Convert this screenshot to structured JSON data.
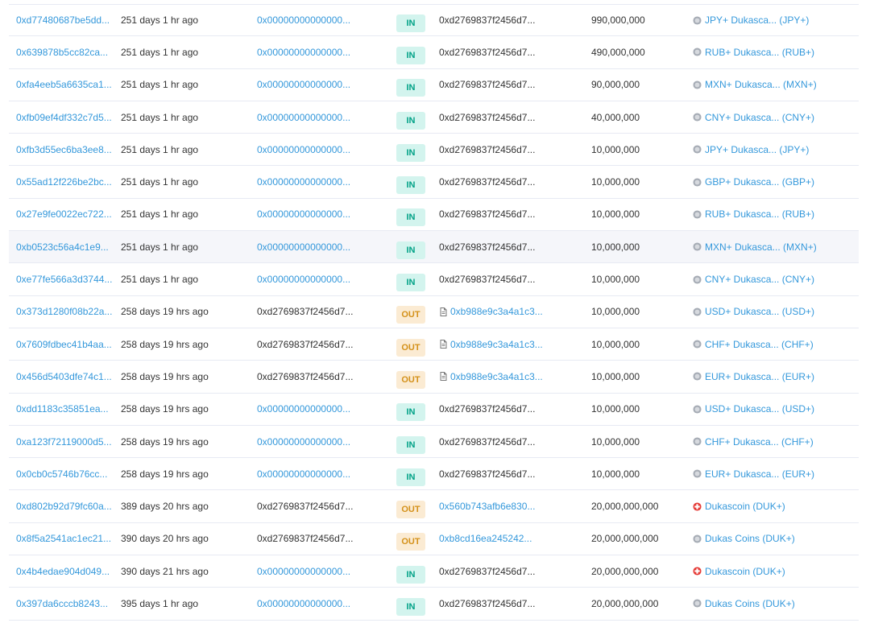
{
  "colors": {
    "link": "#3498db",
    "in_badge_bg": "#d3f4ee",
    "in_badge_text": "#00a186",
    "out_badge_bg": "#fbebd3",
    "out_badge_text": "#d4911a",
    "duk_icon": "#e53935"
  },
  "rows": [
    {
      "hash": "0xd77480687be5dd...",
      "age": "251 days 1 hr ago",
      "from": "0x00000000000000...",
      "from_link": true,
      "direction": "IN",
      "to": "0xd2769837f2456d7...",
      "to_link": false,
      "to_contract": false,
      "quantity": "990,000,000",
      "token": "JPY+ Dukasca... (JPY+)",
      "token_icon": "gray-token-icon"
    },
    {
      "hash": "0x639878b5cc82ca...",
      "age": "251 days 1 hr ago",
      "from": "0x00000000000000...",
      "from_link": true,
      "direction": "IN",
      "to": "0xd2769837f2456d7...",
      "to_link": false,
      "to_contract": false,
      "quantity": "490,000,000",
      "token": "RUB+ Dukasca... (RUB+)",
      "token_icon": "gray-token-icon"
    },
    {
      "hash": "0xfa4eeb5a6635ca1...",
      "age": "251 days 1 hr ago",
      "from": "0x00000000000000...",
      "from_link": true,
      "direction": "IN",
      "to": "0xd2769837f2456d7...",
      "to_link": false,
      "to_contract": false,
      "quantity": "90,000,000",
      "token": "MXN+ Dukasca... (MXN+)",
      "token_icon": "gray-token-icon"
    },
    {
      "hash": "0xfb09ef4df332c7d5...",
      "age": "251 days 1 hr ago",
      "from": "0x00000000000000...",
      "from_link": true,
      "direction": "IN",
      "to": "0xd2769837f2456d7...",
      "to_link": false,
      "to_contract": false,
      "quantity": "40,000,000",
      "token": "CNY+ Dukasca... (CNY+)",
      "token_icon": "gray-token-icon"
    },
    {
      "hash": "0xfb3d55ec6ba3ee8...",
      "age": "251 days 1 hr ago",
      "from": "0x00000000000000...",
      "from_link": true,
      "direction": "IN",
      "to": "0xd2769837f2456d7...",
      "to_link": false,
      "to_contract": false,
      "quantity": "10,000,000",
      "token": "JPY+ Dukasca... (JPY+)",
      "token_icon": "gray-token-icon"
    },
    {
      "hash": "0x55ad12f226be2bc...",
      "age": "251 days 1 hr ago",
      "from": "0x00000000000000...",
      "from_link": true,
      "direction": "IN",
      "to": "0xd2769837f2456d7...",
      "to_link": false,
      "to_contract": false,
      "quantity": "10,000,000",
      "token": "GBP+ Dukasca... (GBP+)",
      "token_icon": "gray-token-icon"
    },
    {
      "hash": "0x27e9fe0022ec722...",
      "age": "251 days 1 hr ago",
      "from": "0x00000000000000...",
      "from_link": true,
      "direction": "IN",
      "to": "0xd2769837f2456d7...",
      "to_link": false,
      "to_contract": false,
      "quantity": "10,000,000",
      "token": "RUB+ Dukasca... (RUB+)",
      "token_icon": "gray-token-icon"
    },
    {
      "hash": "0xb0523c56a4c1e9...",
      "age": "251 days 1 hr ago",
      "from": "0x00000000000000...",
      "from_link": true,
      "direction": "IN",
      "to": "0xd2769837f2456d7...",
      "to_link": false,
      "to_contract": false,
      "quantity": "10,000,000",
      "token": "MXN+ Dukasca... (MXN+)",
      "token_icon": "gray-token-icon",
      "highlight": true
    },
    {
      "hash": "0xe77fe566a3d3744...",
      "age": "251 days 1 hr ago",
      "from": "0x00000000000000...",
      "from_link": true,
      "direction": "IN",
      "to": "0xd2769837f2456d7...",
      "to_link": false,
      "to_contract": false,
      "quantity": "10,000,000",
      "token": "CNY+ Dukasca... (CNY+)",
      "token_icon": "gray-token-icon"
    },
    {
      "hash": "0x373d1280f08b22a...",
      "age": "258 days 19 hrs ago",
      "from": "0xd2769837f2456d7...",
      "from_link": false,
      "direction": "OUT",
      "to": "0xb988e9c3a4a1c3...",
      "to_link": true,
      "to_contract": true,
      "quantity": "10,000,000",
      "token": "USD+ Dukasca... (USD+)",
      "token_icon": "gray-token-icon"
    },
    {
      "hash": "0x7609fdbec41b4aa...",
      "age": "258 days 19 hrs ago",
      "from": "0xd2769837f2456d7...",
      "from_link": false,
      "direction": "OUT",
      "to": "0xb988e9c3a4a1c3...",
      "to_link": true,
      "to_contract": true,
      "quantity": "10,000,000",
      "token": "CHF+ Dukasca... (CHF+)",
      "token_icon": "gray-token-icon"
    },
    {
      "hash": "0x456d5403dfe74c1...",
      "age": "258 days 19 hrs ago",
      "from": "0xd2769837f2456d7...",
      "from_link": false,
      "direction": "OUT",
      "to": "0xb988e9c3a4a1c3...",
      "to_link": true,
      "to_contract": true,
      "quantity": "10,000,000",
      "token": "EUR+ Dukasca... (EUR+)",
      "token_icon": "gray-token-icon"
    },
    {
      "hash": "0xdd1183c35851ea...",
      "age": "258 days 19 hrs ago",
      "from": "0x00000000000000...",
      "from_link": true,
      "direction": "IN",
      "to": "0xd2769837f2456d7...",
      "to_link": false,
      "to_contract": false,
      "quantity": "10,000,000",
      "token": "USD+ Dukasca... (USD+)",
      "token_icon": "gray-token-icon"
    },
    {
      "hash": "0xa123f72119000d5...",
      "age": "258 days 19 hrs ago",
      "from": "0x00000000000000...",
      "from_link": true,
      "direction": "IN",
      "to": "0xd2769837f2456d7...",
      "to_link": false,
      "to_contract": false,
      "quantity": "10,000,000",
      "token": "CHF+ Dukasca... (CHF+)",
      "token_icon": "gray-token-icon"
    },
    {
      "hash": "0x0cb0c5746b76cc...",
      "age": "258 days 19 hrs ago",
      "from": "0x00000000000000...",
      "from_link": true,
      "direction": "IN",
      "to": "0xd2769837f2456d7...",
      "to_link": false,
      "to_contract": false,
      "quantity": "10,000,000",
      "token": "EUR+ Dukasca... (EUR+)",
      "token_icon": "gray-token-icon"
    },
    {
      "hash": "0xd802b92d79fc60a...",
      "age": "389 days 20 hrs ago",
      "from": "0xd2769837f2456d7...",
      "from_link": false,
      "direction": "OUT",
      "to": "0x560b743afb6e830...",
      "to_link": true,
      "to_contract": false,
      "quantity": "20,000,000,000",
      "token": "Dukascoin (DUK+)",
      "token_icon": "red-cross-token-icon"
    },
    {
      "hash": "0x8f5a2541ac1ec21...",
      "age": "390 days 20 hrs ago",
      "from": "0xd2769837f2456d7...",
      "from_link": false,
      "direction": "OUT",
      "to": "0xb8cd16ea245242...",
      "to_link": true,
      "to_contract": false,
      "quantity": "20,000,000,000",
      "token": "Dukas Coins (DUK+)",
      "token_icon": "gray-token-icon"
    },
    {
      "hash": "0x4b4edae904d049...",
      "age": "390 days 21 hrs ago",
      "from": "0x00000000000000...",
      "from_link": true,
      "direction": "IN",
      "to": "0xd2769837f2456d7...",
      "to_link": false,
      "to_contract": false,
      "quantity": "20,000,000,000",
      "token": "Dukascoin (DUK+)",
      "token_icon": "red-cross-token-icon"
    },
    {
      "hash": "0x397da6cccb8243...",
      "age": "395 days 1 hr ago",
      "from": "0x00000000000000...",
      "from_link": true,
      "direction": "IN",
      "to": "0xd2769837f2456d7...",
      "to_link": false,
      "to_contract": false,
      "quantity": "20,000,000,000",
      "token": "Dukas Coins (DUK+)",
      "token_icon": "gray-token-icon"
    }
  ]
}
